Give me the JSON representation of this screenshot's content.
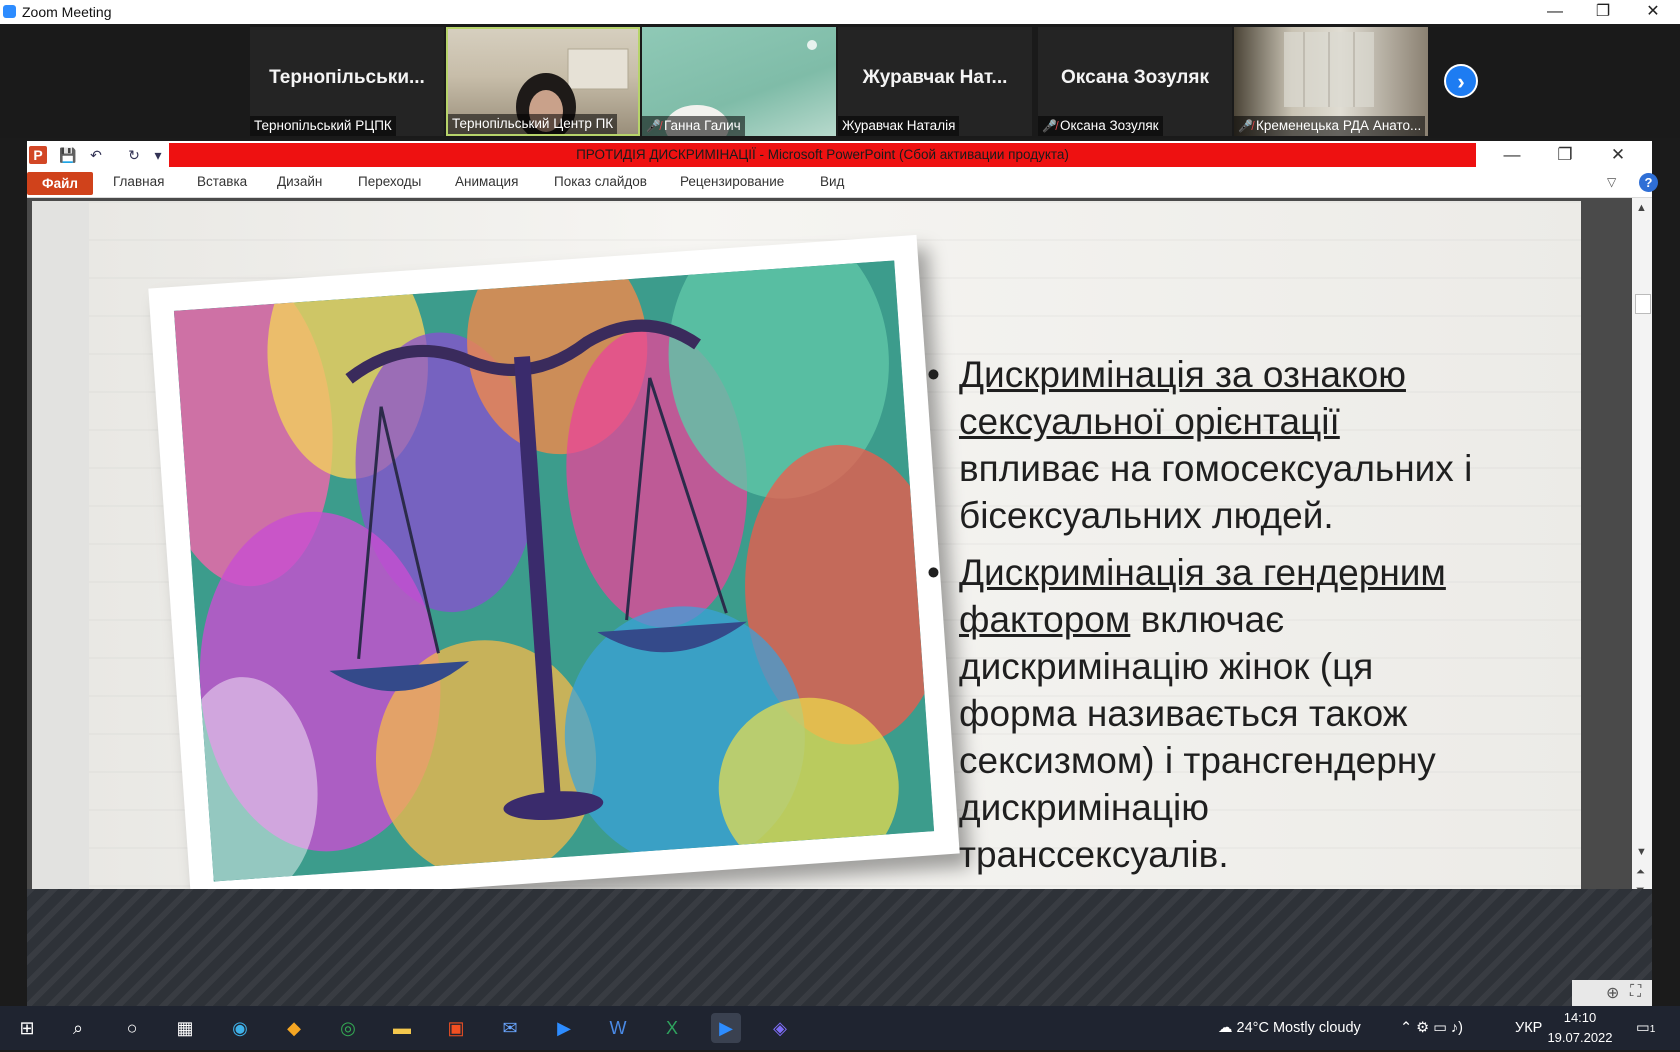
{
  "zoom": {
    "title": "Zoom Meeting",
    "controls": {
      "minimize": "—",
      "restore": "❐",
      "close": "✕"
    },
    "participants": [
      {
        "display": "Тернопільськи...",
        "caption": "Тернопільський РЦПК",
        "muted": false,
        "video": false
      },
      {
        "display": "",
        "caption": "Тернопільський Центр ПК",
        "muted": false,
        "video": true,
        "active": true
      },
      {
        "display": "",
        "caption": "Ганна Галич",
        "muted": true,
        "video": true
      },
      {
        "display": "Журавчак Нат...",
        "caption": "Журавчак Наталія",
        "muted": false,
        "video": false
      },
      {
        "display": "Оксана Зозуляк",
        "caption": "Оксана Зозуляк",
        "muted": true,
        "video": false
      },
      {
        "display": "",
        "caption": "Кременецька РДА Анато...",
        "muted": true,
        "video": true
      }
    ],
    "next_label": "›"
  },
  "ppt": {
    "title": "ПРОТИДІЯ ДИСКРИМІНАЦІЇ  -  Microsoft PowerPoint (Сбой активации продукта)",
    "tabs": [
      "Файл",
      "Главная",
      "Вставка",
      "Дизайн",
      "Переходы",
      "Анимация",
      "Показ слайдов",
      "Рецензирование",
      "Вид"
    ],
    "help": "?",
    "slide": {
      "bullet1_u": "Дискримінація за ознакою сексуальної орієнтації",
      "bullet1_rest": " впливає на гомосексуальних і бісексуальних людей.",
      "bullet2_u": "Дискримінація за гендерним фактором",
      "bullet2_rest": " включає дискримінацію жінок (ця форма називається також сексизмом) і трансгендерну дискримінацію транссексуалів."
    }
  },
  "taskbar": {
    "weather": "24°C  Mostly cloudy",
    "lang": "УКР",
    "time": "14:10",
    "date": "19.07.2022",
    "notifications": "1"
  },
  "colors": {
    "ppt_title_bar": "#ee1111",
    "file_tab": "#d0421b",
    "zoom_blue": "#1d7cf2"
  }
}
